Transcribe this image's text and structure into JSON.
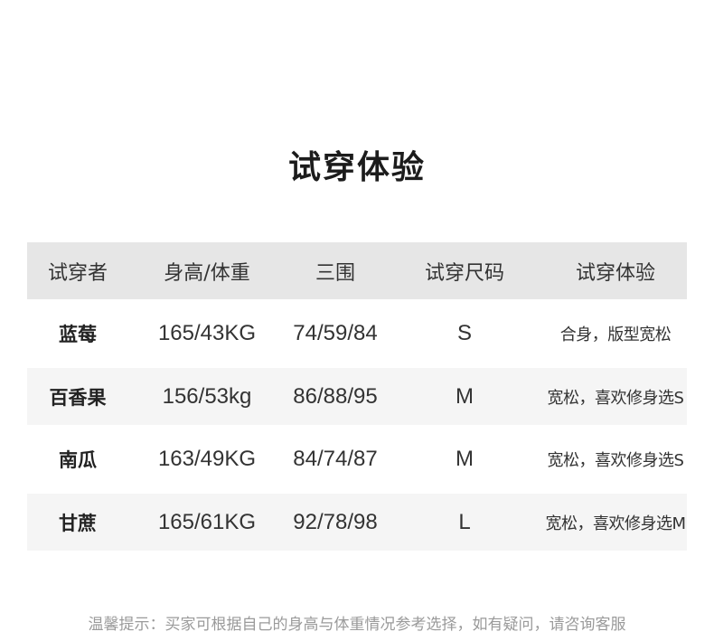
{
  "title": "试穿体验",
  "headers": [
    "试穿者",
    "身高/体重",
    "三围",
    "试穿尺码",
    "试穿体验"
  ],
  "rows": [
    [
      "蓝莓",
      "165/43KG",
      "74/59/84",
      "S",
      "合身，版型宽松"
    ],
    [
      "百香果",
      "156/53kg",
      "86/88/95",
      "M",
      "宽松，喜欢修身选S"
    ],
    [
      "南瓜",
      "163/49KG",
      "84/74/87",
      "M",
      "宽松，喜欢修身选S"
    ],
    [
      "甘蔗",
      "165/61KG",
      "92/78/98",
      "L",
      "宽松，喜欢修身选M"
    ]
  ],
  "note": "温馨提示：买家可根据自己的身高与体重情况参考选择，如有疑问，请咨询客服"
}
